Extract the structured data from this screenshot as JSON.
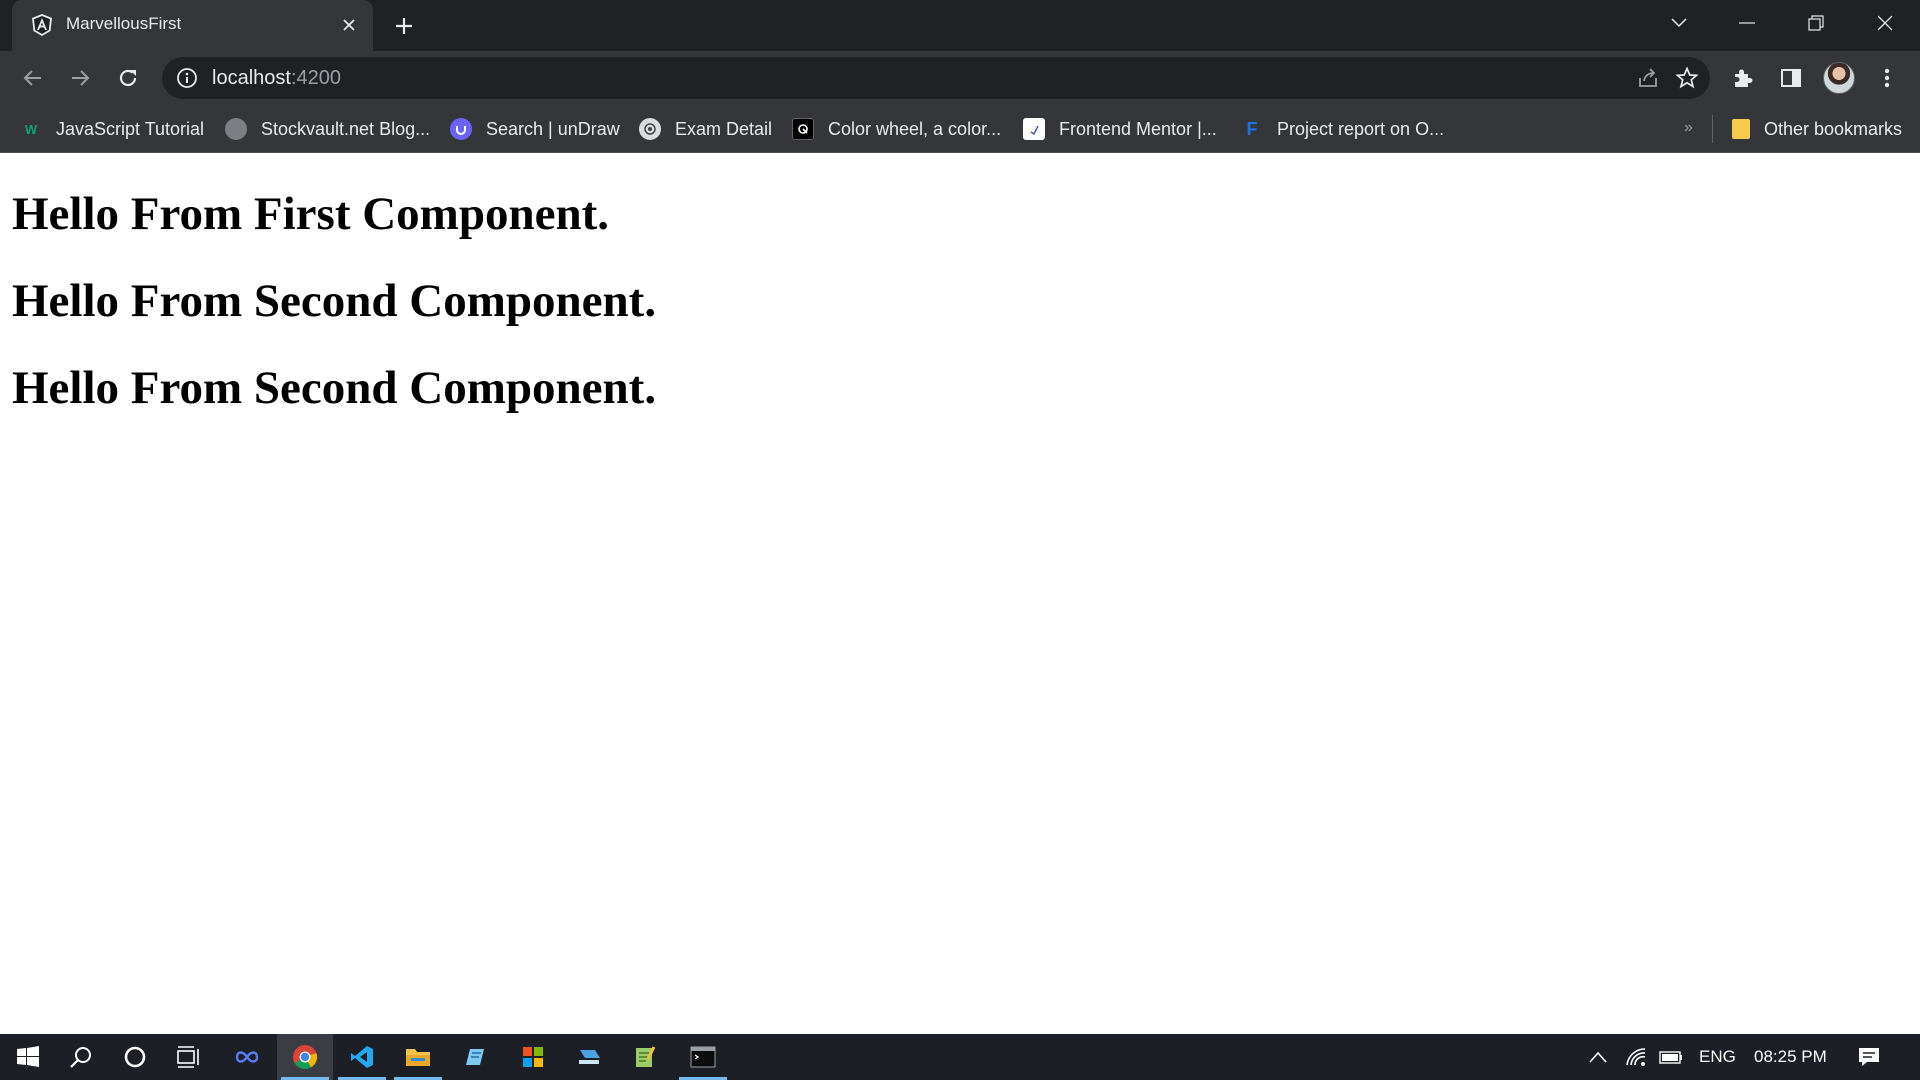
{
  "browser": {
    "tab": {
      "title": "MarvellousFirst",
      "favicon": "angular-icon"
    },
    "address_bar": {
      "host": "localhost",
      "port": ":4200"
    },
    "bookmarks": [
      {
        "label": "JavaScript Tutorial",
        "icon": "w3schools-icon",
        "color": "#04aa6d"
      },
      {
        "label": "Stockvault.net Blog...",
        "icon": "stockvault-icon",
        "color": "#9aa0a6"
      },
      {
        "label": "Search | unDraw",
        "icon": "undraw-icon",
        "color": "#6c63ff"
      },
      {
        "label": "Exam Detail",
        "icon": "exam-icon",
        "color": "#dadce0"
      },
      {
        "label": "Color wheel, a color...",
        "icon": "adobe-color-icon",
        "color": "#000000"
      },
      {
        "label": "Frontend Mentor |...",
        "icon": "frontend-mentor-icon",
        "color": "#ffffff"
      },
      {
        "label": "Project report on O...",
        "icon": "project-report-icon",
        "color": "#1a73e8"
      }
    ],
    "other_bookmarks": "Other bookmarks",
    "more_bookmarks": "»"
  },
  "page": {
    "headings": [
      "Hello From First Component.",
      "Hello From Second Component.",
      "Hello From Second Component."
    ]
  },
  "taskbar": {
    "language": "ENG",
    "time": "08:25 PM",
    "apps": [
      "start-icon",
      "search-icon",
      "cortana-icon",
      "task-view-icon",
      "infinity-app-icon",
      "chrome-icon",
      "vscode-icon",
      "file-explorer-icon",
      "notepad-icon",
      "office-icon",
      "app-icon",
      "notepadpp-icon",
      "terminal-icon"
    ]
  },
  "colors": {
    "tabstrip": "#202124",
    "toolbar": "#35363a",
    "taskbar": "#1c1f26",
    "accent": "#76b9ed"
  }
}
